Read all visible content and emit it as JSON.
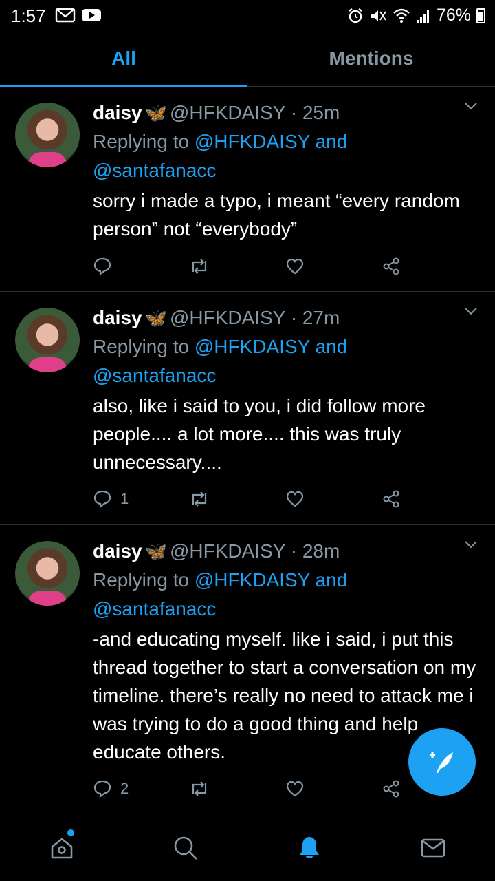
{
  "status_bar": {
    "time": "1:57",
    "battery": "76%"
  },
  "tabs": [
    {
      "label": "All",
      "active": true
    },
    {
      "label": "Mentions",
      "active": false
    }
  ],
  "tweets": [
    {
      "name": "daisy",
      "handle": "@HFKDAISY",
      "time": "25m",
      "replying_prefix": "Replying to",
      "replying_to_1": "@HFKDAISY",
      "replying_and": "and",
      "replying_to_2": "@santafanacc",
      "text": "sorry i made a typo, i meant “every random person” not “everybody”",
      "reply_count": ""
    },
    {
      "name": "daisy",
      "handle": "@HFKDAISY",
      "time": "27m",
      "replying_prefix": "Replying to",
      "replying_to_1": "@HFKDAISY",
      "replying_and": "and",
      "replying_to_2": "@santafanacc",
      "text": "also, like i said to you, i did follow more people.... a lot more.... this was truly unnecessary....",
      "reply_count": "1"
    },
    {
      "name": "daisy",
      "handle": "@HFKDAISY",
      "time": "28m",
      "replying_prefix": "Replying to",
      "replying_to_1": "@HFKDAISY",
      "replying_and": "and",
      "replying_to_2": "@santafanacc",
      "text": "-and educating myself. like i said, i put this thread together to start a conversation on my timeline. there’s really no need to attack me i was trying to do a good thing and help educate others.",
      "reply_count": "2"
    }
  ],
  "bottom_nav": [
    {
      "icon": "home-icon",
      "active": false,
      "has_dot": true
    },
    {
      "icon": "search-icon",
      "active": false
    },
    {
      "icon": "notifications-icon",
      "active": true
    },
    {
      "icon": "messages-icon",
      "active": false
    }
  ],
  "colors": {
    "background": "#000000",
    "accent": "#1da1f2",
    "secondary_text": "#8899a6",
    "divider": "#2f3336"
  }
}
